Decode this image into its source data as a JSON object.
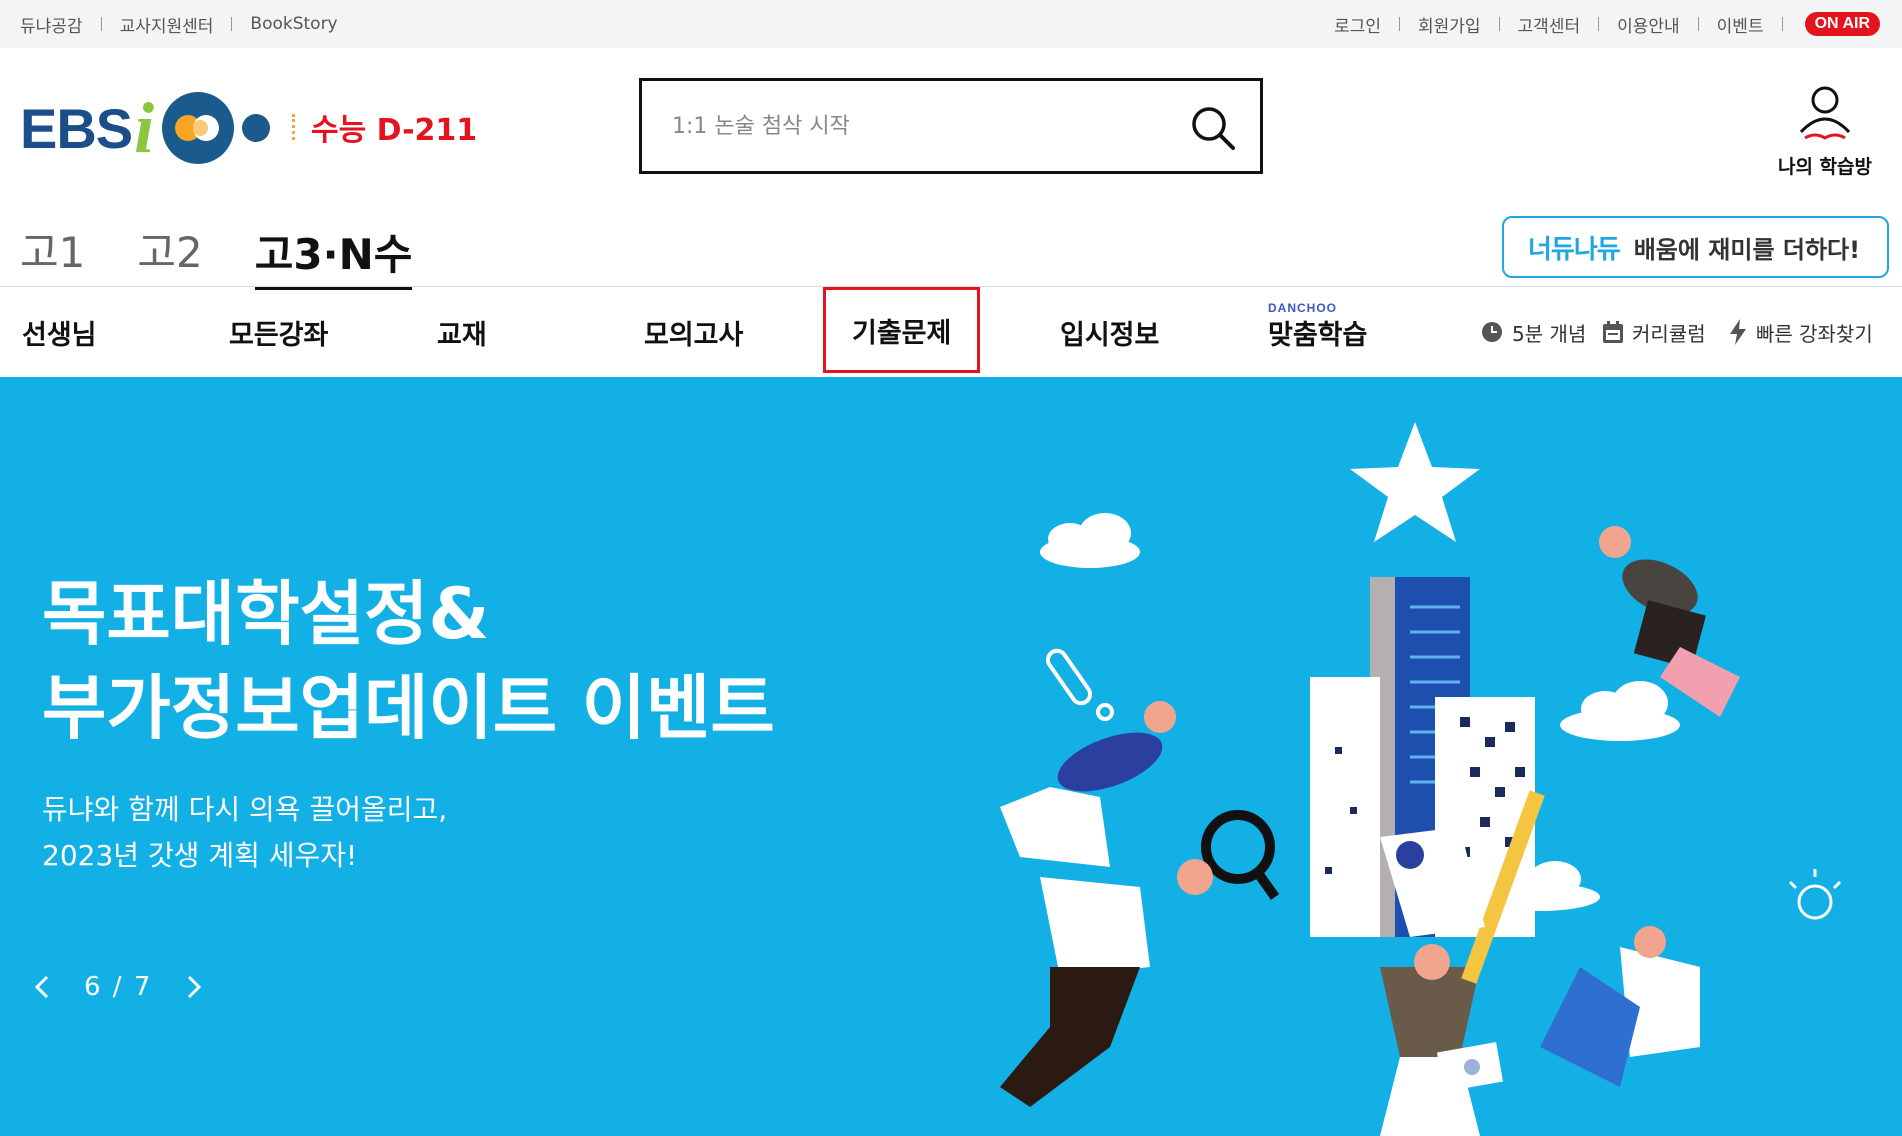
{
  "util": {
    "left": [
      "듀냐공감",
      "교사지원센터",
      "BookStory"
    ],
    "right": [
      "로그인",
      "회원가입",
      "고객센터",
      "이용안내",
      "이벤트"
    ],
    "onair": "ON AIR"
  },
  "logo": {
    "ebs": "EBS",
    "i": "i"
  },
  "dday": "수능 D-211",
  "search": {
    "placeholder": "1:1 논술 첨삭 시작"
  },
  "mystudy": "나의 학습방",
  "grade_tabs": [
    "고1",
    "고2",
    "고3·N수"
  ],
  "grade_active": "고3·N수",
  "promo": {
    "brand": "너듀나듀",
    "text": "배움에 재미를 더하다!"
  },
  "gnb": [
    "선생님",
    "모든강좌",
    "교재",
    "모의고사",
    "기출문제",
    "입시정보",
    "맞춤학습"
  ],
  "danchoo": "DANCHOO",
  "quick": [
    "5분 개념",
    "커리큘럼",
    "빠른 강좌찾기"
  ],
  "banner": {
    "title_line1": "목표대학설정&",
    "title_line2": "부가정보업데이트 이벤트",
    "sub_line1": "듀냐와 함께 다시 의욕 끌어올리고,",
    "sub_line2": "2023년 갓생 계획 세우자!",
    "pager": "6 / 7"
  },
  "colors": {
    "brand_red": "#e4131e",
    "banner_blue": "#13b0e6",
    "logo_navy": "#1c4e8a",
    "logo_green": "#8cc63f"
  }
}
